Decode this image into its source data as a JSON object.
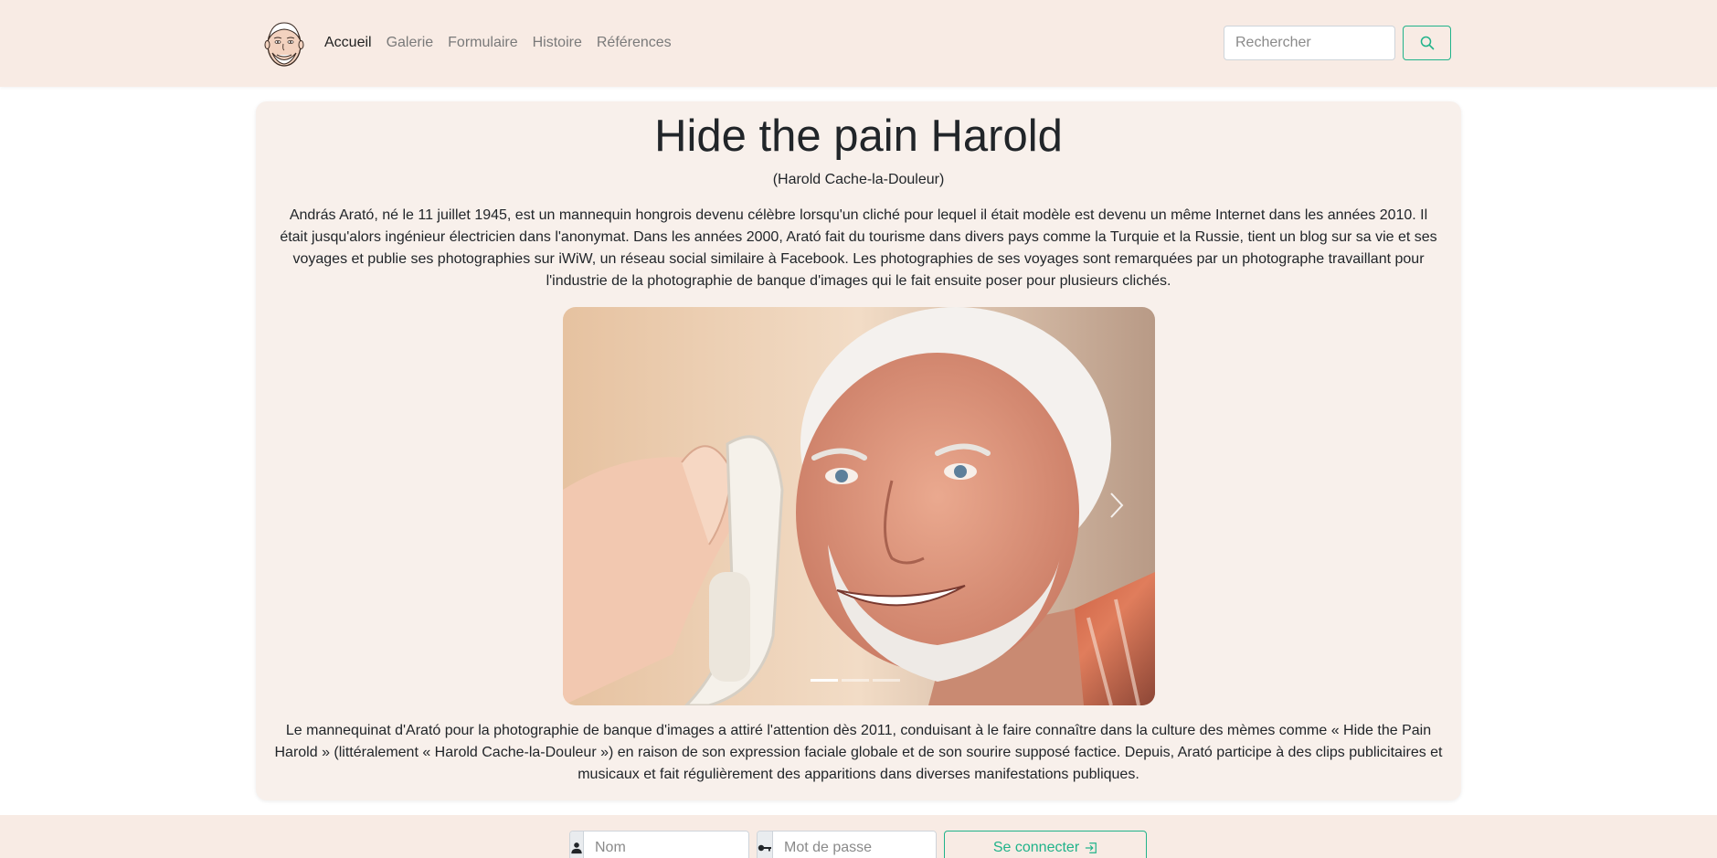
{
  "nav": {
    "logo_alt": "Harold",
    "links": [
      {
        "label": "Accueil",
        "active": true
      },
      {
        "label": "Galerie",
        "active": false
      },
      {
        "label": "Formulaire",
        "active": false
      },
      {
        "label": "Histoire",
        "active": false
      },
      {
        "label": "Références",
        "active": false
      }
    ],
    "search_placeholder": "Rechercher",
    "search_icon": "search-icon"
  },
  "main": {
    "title": "Hide the pain Harold",
    "subtitle": "(Harold Cache-la-Douleur)",
    "intro": "András Arató, né le 11 juillet 1945, est un mannequin hongrois devenu célèbre lorsqu'un cliché pour lequel il était modèle est devenu un même Internet dans les années 2010. Il était jusqu'alors ingénieur électricien dans l'anonymat. Dans les années 2000, Arató fait du tourisme dans divers pays comme la Turquie et la Russie, tient un blog sur sa vie et ses voyages et publie ses photographies sur iWiW, un réseau social similaire à Facebook. Les photographies de ses voyages sont remarquées par un photographe travaillant pour l'industrie de la photographie de banque d'images qui le fait ensuite poser pour plusieurs clichés.",
    "outro": "Le mannequinat d'Arató pour la photographie de banque d'images a attiré l'attention dès 2011, conduisant à le faire connaître dans la culture des mèmes comme « Hide the Pain Harold » (littéralement « Harold Cache-la-Douleur ») en raison de son expression faciale globale et de son sourire supposé factice. Depuis, Arató participe à des clips publicitaires et musicaux et fait régulièrement des apparitions dans diverses manifestations publiques."
  },
  "carousel": {
    "slide_count": 3,
    "active_slide": 1,
    "next_icon": "chevron-right-icon"
  },
  "footer": {
    "name_placeholder": "Nom",
    "password_placeholder": "Mot de passe",
    "login_label": "Se connecter",
    "user_icon": "person-icon",
    "key_icon": "key-icon",
    "login_icon": "box-arrow-in-right-icon"
  },
  "colors": {
    "navbar_bg": "#f8ebe4",
    "card_bg": "#f8f0eb",
    "accent": "#20b38a"
  }
}
